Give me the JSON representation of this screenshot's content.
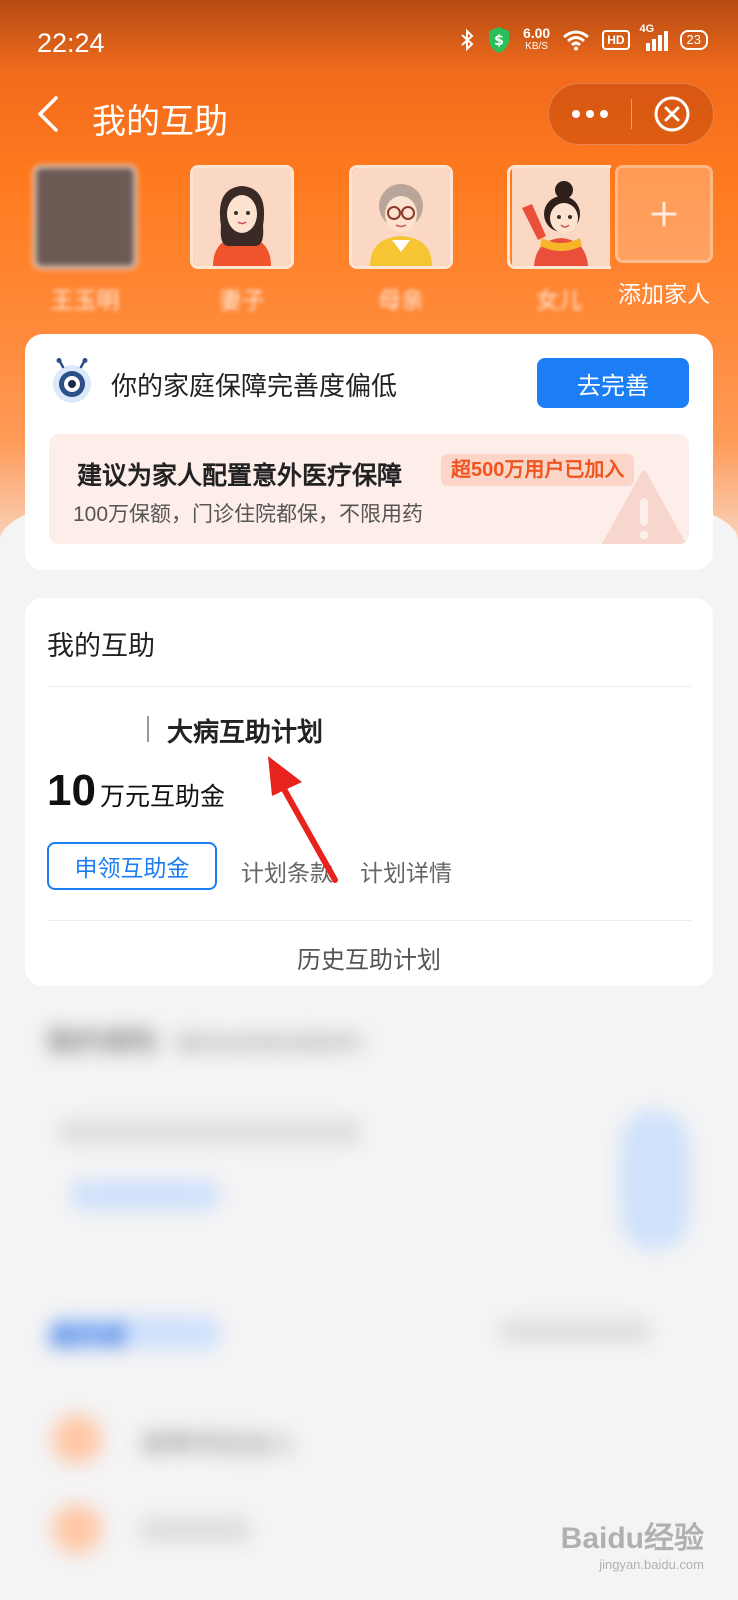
{
  "status_bar": {
    "time": "22:24",
    "net_speed": "6.00",
    "net_unit": "KB/S",
    "hd": "HD",
    "signal": "4G",
    "battery": "23"
  },
  "nav": {
    "title": "我的互助",
    "more": "•••"
  },
  "family": {
    "members": [
      {
        "name": "王玉明"
      },
      {
        "name": "妻子"
      },
      {
        "name": "母亲"
      },
      {
        "name": "女儿"
      }
    ],
    "add_label": "添加家人"
  },
  "protection_card": {
    "status_text": "你的家庭保障完善度偏低",
    "button_label": "去完善",
    "tip_title": "建议为家人配置意外医疗保障",
    "tip_badge": "超500万用户已加入",
    "tip_subtitle": "100万保额，门诊住院都保，不限用药"
  },
  "mutual_aid_card": {
    "title": "我的互助",
    "plan_name": "大病互助计划",
    "amount_number": "10",
    "amount_unit": "万元互助金",
    "claim_button": "申领互助金",
    "link_terms": "计划条款",
    "link_details": "计划详情",
    "history_link": "历史互助计划"
  },
  "blurred_section": {
    "title": "我的保险",
    "title_note": "（服务由蚂蚁保提供）",
    "section2_title": "我的保",
    "item1": "保障项目加入"
  },
  "watermark": {
    "brand": "Baidu经验",
    "url": "jingyan.baidu.com"
  },
  "colors": {
    "brand_orange": "#ff7a1e",
    "primary_blue": "#1b7ef5",
    "badge_red": "#f0541e"
  }
}
